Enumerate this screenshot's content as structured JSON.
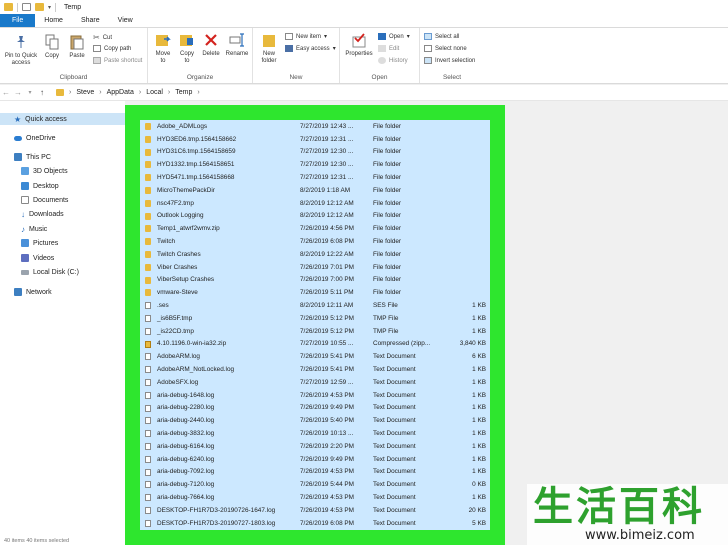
{
  "window": {
    "title": "Temp"
  },
  "ribbon": {
    "tabs": [
      "File",
      "Home",
      "Share",
      "View"
    ],
    "clipboard": {
      "label": "Clipboard",
      "pin": "Pin to Quick\naccess",
      "copy": "Copy",
      "paste": "Paste",
      "cut": "Cut",
      "copy_path": "Copy path",
      "paste_shortcut": "Paste shortcut"
    },
    "organize": {
      "label": "Organize",
      "move_to": "Move\nto",
      "copy_to": "Copy\nto",
      "delete": "Delete",
      "rename": "Rename"
    },
    "new": {
      "label": "New",
      "new_folder": "New\nfolder",
      "new_item": "New item",
      "easy_access": "Easy access"
    },
    "open": {
      "label": "Open",
      "properties": "Properties",
      "open": "Open",
      "edit": "Edit",
      "history": "History"
    },
    "select": {
      "label": "Select",
      "select_all": "Select all",
      "select_none": "Select none",
      "invert_selection": "Invert selection"
    }
  },
  "address": {
    "path": [
      "Steve",
      "AppData",
      "Local",
      "Temp"
    ]
  },
  "nav": {
    "quick_access": "Quick access",
    "onedrive": "OneDrive",
    "this_pc": "This PC",
    "items": [
      "3D Objects",
      "Desktop",
      "Documents",
      "Downloads",
      "Music",
      "Pictures",
      "Videos",
      "Local Disk (C:)"
    ],
    "network": "Network"
  },
  "files": [
    {
      "name": "Adobe_ADMLogs",
      "date": "7/27/2019 12:43 ...",
      "type": "File folder",
      "size": "",
      "icon": "folder"
    },
    {
      "name": "HYD3ED6.tmp.1564158662",
      "date": "7/27/2019 12:31 ...",
      "type": "File folder",
      "size": "",
      "icon": "folder"
    },
    {
      "name": "HYD31C6.tmp.1564158659",
      "date": "7/27/2019 12:30 ...",
      "type": "File folder",
      "size": "",
      "icon": "folder"
    },
    {
      "name": "HYD1332.tmp.1564158651",
      "date": "7/27/2019 12:30 ...",
      "type": "File folder",
      "size": "",
      "icon": "folder"
    },
    {
      "name": "HYD5471.tmp.1564158668",
      "date": "7/27/2019 12:31 ...",
      "type": "File folder",
      "size": "",
      "icon": "folder"
    },
    {
      "name": "MicroThemePackDir",
      "date": "8/2/2019 1:18 AM",
      "type": "File folder",
      "size": "",
      "icon": "folder"
    },
    {
      "name": "nsc47F2.tmp",
      "date": "8/2/2019 12:12 AM",
      "type": "File folder",
      "size": "",
      "icon": "folder"
    },
    {
      "name": "Outlook Logging",
      "date": "8/2/2019 12:12 AM",
      "type": "File folder",
      "size": "",
      "icon": "folder"
    },
    {
      "name": "Temp1_atwrf2wmv.zip",
      "date": "7/26/2019 4:56 PM",
      "type": "File folder",
      "size": "",
      "icon": "folder"
    },
    {
      "name": "Twitch",
      "date": "7/26/2019 6:08 PM",
      "type": "File folder",
      "size": "",
      "icon": "folder"
    },
    {
      "name": "Twitch Crashes",
      "date": "8/2/2019 12:22 AM",
      "type": "File folder",
      "size": "",
      "icon": "folder"
    },
    {
      "name": "Viber Crashes",
      "date": "7/26/2019 7:01 PM",
      "type": "File folder",
      "size": "",
      "icon": "folder"
    },
    {
      "name": "ViberSetup Crashes",
      "date": "7/26/2019 7:00 PM",
      "type": "File folder",
      "size": "",
      "icon": "folder"
    },
    {
      "name": "vmware-Steve",
      "date": "7/26/2019 5:11 PM",
      "type": "File folder",
      "size": "",
      "icon": "folder"
    },
    {
      "name": ".ses",
      "date": "8/2/2019 12:11 AM",
      "type": "SES File",
      "size": "1 KB",
      "icon": "doc"
    },
    {
      "name": "_is6B5F.tmp",
      "date": "7/26/2019 5:12 PM",
      "type": "TMP File",
      "size": "1 KB",
      "icon": "doc"
    },
    {
      "name": "_is22CD.tmp",
      "date": "7/26/2019 5:12 PM",
      "type": "TMP File",
      "size": "1 KB",
      "icon": "doc"
    },
    {
      "name": "4.10.1196.0-win-ia32.zip",
      "date": "7/27/2019 10:55 ...",
      "type": "Compressed (zipp...",
      "size": "3,840 KB",
      "icon": "zip"
    },
    {
      "name": "AdobeARM.log",
      "date": "7/26/2019 5:41 PM",
      "type": "Text Document",
      "size": "6 KB",
      "icon": "doc"
    },
    {
      "name": "AdobeARM_NotLocked.log",
      "date": "7/26/2019 5:41 PM",
      "type": "Text Document",
      "size": "1 KB",
      "icon": "doc"
    },
    {
      "name": "AdobeSFX.log",
      "date": "7/27/2019 12:59 ...",
      "type": "Text Document",
      "size": "1 KB",
      "icon": "doc"
    },
    {
      "name": "aria-debug-1648.log",
      "date": "7/26/2019 4:53 PM",
      "type": "Text Document",
      "size": "1 KB",
      "icon": "doc"
    },
    {
      "name": "aria-debug-2280.log",
      "date": "7/26/2019 9:49 PM",
      "type": "Text Document",
      "size": "1 KB",
      "icon": "doc"
    },
    {
      "name": "aria-debug-2440.log",
      "date": "7/26/2019 5:40 PM",
      "type": "Text Document",
      "size": "1 KB",
      "icon": "doc"
    },
    {
      "name": "aria-debug-3832.log",
      "date": "7/26/2019 10:13 ...",
      "type": "Text Document",
      "size": "1 KB",
      "icon": "doc"
    },
    {
      "name": "aria-debug-6164.log",
      "date": "7/26/2019 2:20 PM",
      "type": "Text Document",
      "size": "1 KB",
      "icon": "doc"
    },
    {
      "name": "aria-debug-6240.log",
      "date": "7/26/2019 9:49 PM",
      "type": "Text Document",
      "size": "1 KB",
      "icon": "doc"
    },
    {
      "name": "aria-debug-7092.log",
      "date": "7/26/2019 4:53 PM",
      "type": "Text Document",
      "size": "1 KB",
      "icon": "doc"
    },
    {
      "name": "aria-debug-7120.log",
      "date": "7/26/2019 5:44 PM",
      "type": "Text Document",
      "size": "0 KB",
      "icon": "doc"
    },
    {
      "name": "aria-debug-7664.log",
      "date": "7/26/2019 4:53 PM",
      "type": "Text Document",
      "size": "1 KB",
      "icon": "doc"
    },
    {
      "name": "DESKTOP-FH1R7D3-20190726-1647.log",
      "date": "7/26/2019 4:53 PM",
      "type": "Text Document",
      "size": "20 KB",
      "icon": "doc"
    },
    {
      "name": "DESKTOP-FH1R7D3-20190727-1803.log",
      "date": "7/26/2019 6:08 PM",
      "type": "Text Document",
      "size": "5 KB",
      "icon": "doc"
    }
  ],
  "statusbar": {
    "text": "40 items    40 items selected"
  },
  "watermark": {
    "chars": [
      "生",
      "活",
      "百",
      "科"
    ],
    "url": "www.bimeiz.com"
  },
  "colors": {
    "selection": "#cce8ff",
    "highlight_green": "#2ee62e",
    "file_tab": "#1979ca",
    "folder": "#e8b93c"
  }
}
